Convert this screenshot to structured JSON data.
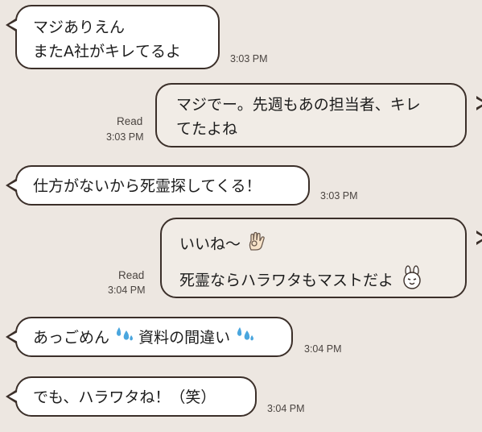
{
  "messages": [
    {
      "side": "in",
      "lines": [
        "マジありえん",
        "またA社がキレてるよ"
      ],
      "time": "3:03 PM"
    },
    {
      "side": "out",
      "lines": [
        "マジでー。先週もあの担当者、キレ",
        "てたよね"
      ],
      "read": "Read",
      "time": "3:03 PM"
    },
    {
      "side": "in",
      "lines": [
        "仕方がないから死霊探してくる！"
      ],
      "time": "3:03 PM"
    },
    {
      "side": "out",
      "lines": [
        "いいね〜",
        "死霊ならハラワタもマストだよ"
      ],
      "read": "Read",
      "time": "3:04 PM"
    },
    {
      "side": "in",
      "parts": [
        "あっごめん",
        "資料の間違い"
      ],
      "time": "3:04 PM"
    },
    {
      "side": "in",
      "lines": [
        "でも、ハラワタね！（笑）"
      ],
      "time": "3:04 PM"
    }
  ],
  "icons": {
    "ok_hand": "ok-hand-emoji",
    "bunny": "bunny-sticker-emoji",
    "sweat": "sweat-droplets-emoji"
  },
  "colors": {
    "background": "#ede7e1",
    "bubble_in": "#ffffff",
    "bubble_out": "#f1ece6",
    "border": "#3b2f29"
  }
}
